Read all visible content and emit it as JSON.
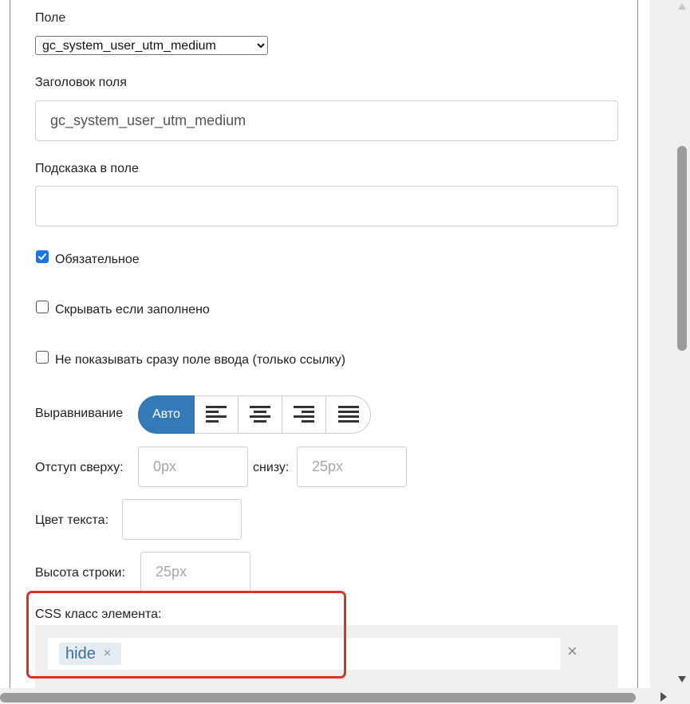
{
  "form": {
    "field_label": "Поле",
    "field_select_value": "gc_system_user_utm_medium",
    "title_label": "Заголовок поля",
    "title_value": "gc_system_user_utm_medium",
    "hint_label": "Подсказка в поле",
    "hint_value": "",
    "required_label": "Обязательное",
    "required_checked": true,
    "hide_if_filled_label": "Скрывать если заполнено",
    "hide_if_filled_checked": false,
    "link_only_label": "Не показывать сразу поле ввода (только ссылку)",
    "link_only_checked": false,
    "align_label": "Выравнивание",
    "align_auto_label": "Авто",
    "margin_top_label": "Отступ сверху:",
    "margin_top_placeholder": "0px",
    "margin_bottom_label": "снизу:",
    "margin_bottom_placeholder": "25px",
    "text_color_label": "Цвет текста:",
    "line_height_label": "Высота строки:",
    "line_height_placeholder": "25px",
    "css_class_label": "CSS класс элемента:",
    "css_tags": [
      "hide"
    ],
    "tag_remove_glyph": "×",
    "clear_glyph": "×"
  },
  "colors": {
    "accent": "#337ab7",
    "checkbox": "#1a73e8",
    "highlight": "#d9322a"
  },
  "icons": [
    "align-left-icon",
    "align-center-icon",
    "align-right-icon",
    "align-justify-icon",
    "check-icon",
    "close-icon"
  ]
}
